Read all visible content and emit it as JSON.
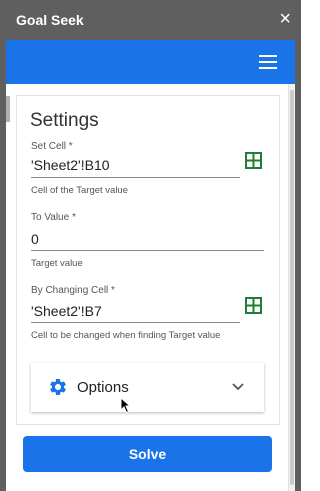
{
  "window": {
    "title": "Goal Seek",
    "close_symbol": "×"
  },
  "header": {
    "menu_icon": "hamburger-icon",
    "accent_color": "#1a73e8"
  },
  "settings": {
    "title": "Settings",
    "set_cell": {
      "label": "Set Cell *",
      "value": "'Sheet2'!B10",
      "help": "Cell of the Target value",
      "icon": "grid-icon"
    },
    "to_value": {
      "label": "To Value *",
      "value": "0",
      "help": "Target value"
    },
    "changing_cell": {
      "label": "By Changing Cell *",
      "value": "'Sheet2'!B7",
      "help": "Cell to be changed when finding Target value",
      "icon": "grid-icon"
    }
  },
  "options": {
    "label": "Options",
    "icon": "gear-icon",
    "expand_icon": "chevron-down-icon"
  },
  "solve_button": {
    "label": "Solve"
  },
  "colors": {
    "titlebar": "#5f5f5f",
    "primary": "#1a73e8",
    "grid_icon": "#1e7e34"
  }
}
